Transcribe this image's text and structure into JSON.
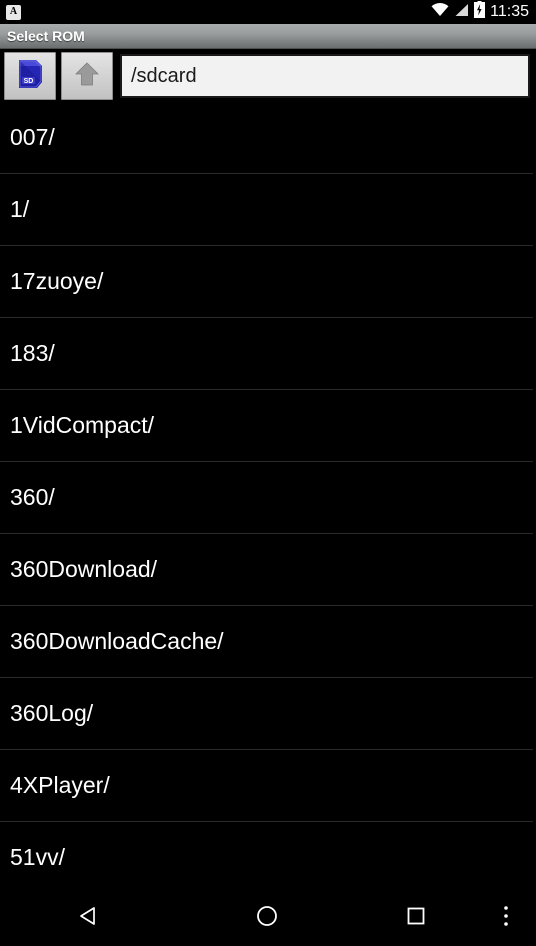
{
  "status_bar": {
    "notification_icon": "notification-a-icon",
    "notification_letter": "A",
    "wifi_icon": "wifi-icon",
    "signal_icon": "signal-icon",
    "battery_icon": "battery-charging-icon",
    "time": "11:35"
  },
  "title_bar": {
    "title": "Select ROM",
    "background_top": "#a9acac",
    "background_bottom": "#6a6e6e"
  },
  "toolbar": {
    "sdcard_button": {
      "icon": "sdcard-icon",
      "label": "SD"
    },
    "up_button": {
      "icon": "arrow-up-icon"
    },
    "path_input": {
      "value": "/sdcard",
      "placeholder": "/sdcard"
    }
  },
  "file_list": {
    "entries": [
      {
        "name": "007/"
      },
      {
        "name": "1/"
      },
      {
        "name": "17zuoye/"
      },
      {
        "name": "183/"
      },
      {
        "name": "1VidCompact/"
      },
      {
        "name": "360/"
      },
      {
        "name": "360Download/"
      },
      {
        "name": "360DownloadCache/"
      },
      {
        "name": "360Log/"
      },
      {
        "name": "4XPlayer/"
      },
      {
        "name": "51vv/"
      }
    ]
  },
  "nav_bar": {
    "back": "back-icon",
    "home": "home-icon",
    "recents": "recents-icon",
    "overflow": "overflow-menu-icon"
  },
  "colors": {
    "background": "#000000",
    "text": "#ffffff",
    "divider": "#2a2a2a",
    "accent_sdcard": "#2222bb"
  }
}
